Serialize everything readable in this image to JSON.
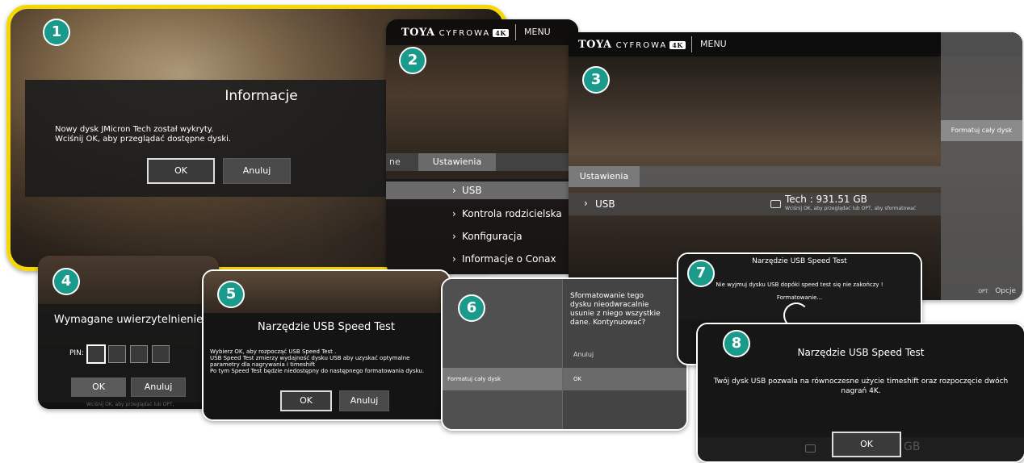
{
  "colors": {
    "accent": "#1a9a8a",
    "highlight": "#f5d800"
  },
  "panel1": {
    "badge": "1",
    "title": "Informacje",
    "line1": "Nowy dysk JMicron Tech został wykryty.",
    "line2": "Wciśnij OK, aby przeglądać dostępne dyski.",
    "ok": "OK",
    "cancel": "Anuluj"
  },
  "panel2": {
    "badge": "2",
    "logo_toya": "TOYA",
    "logo_cyfrowa": "CYFROWA",
    "logo_4k": "4K",
    "menu": "MENU",
    "tab_left": "ne",
    "tab_settings": "Ustawienia",
    "items": [
      "USB",
      "Kontrola rodzicielska",
      "Konfiguracja",
      "Informacje o Conax"
    ]
  },
  "panel3": {
    "badge": "3",
    "logo_toya": "TOYA",
    "logo_cyfrowa": "CYFROWA",
    "logo_4k": "4K",
    "menu": "MENU",
    "settings": "Ustawienia",
    "usb": "USB",
    "disk": "Tech : 931.51 GB",
    "disk_hint": "Wciśnij OK, aby przeglądać lub OPT, aby sformatować",
    "side_option": "Formatuj cały dysk",
    "opt_key": "OPT",
    "opt_label": "Opcje"
  },
  "panel4": {
    "badge": "4",
    "title": "Wymagane uwierzytelnienie",
    "pin_label": "PIN:",
    "ok": "OK",
    "cancel": "Anuluj",
    "bottom_hint": "Wciśnij OK, aby przeglądać lub OPT,"
  },
  "panel5": {
    "badge": "5",
    "title": "Narzędzie USB Speed Test",
    "line1": "Wybierz OK, aby rozpocząć USB Speed Test .",
    "line2": "USB Speed Test zmierzy wydajność dysku USB aby uzyskać optymalne",
    "line3": "parametry dla nagrywania i timeshift",
    "line4": "Po tym Speed Test będzie niedostępny do następnego formatowania dysku.",
    "ok": "OK",
    "cancel": "Anuluj"
  },
  "panel6": {
    "badge": "6",
    "question": "Sformatowanie tego dysku nieodwracalnie usunie z niego wszystkie dane. Kontynuować?",
    "cancel": "Anuluj",
    "format": "Formatuj cały dysk",
    "ok": "OK"
  },
  "panel7": {
    "badge": "7",
    "title": "Narzędzie USB Speed Test",
    "warning": "Nie wyjmuj dysku USB dopóki speed test się nie zakończy !",
    "status": "Formatowanie..."
  },
  "panel8": {
    "badge": "8",
    "title": "Narzędzie USB Speed Test",
    "line1": "Twój dysk USB pozwala na równoczesne użycie timeshift oraz rozpoczęcie dwóch",
    "line2": "nagrań 4K.",
    "ok": "OK",
    "bg_text": "GB"
  }
}
